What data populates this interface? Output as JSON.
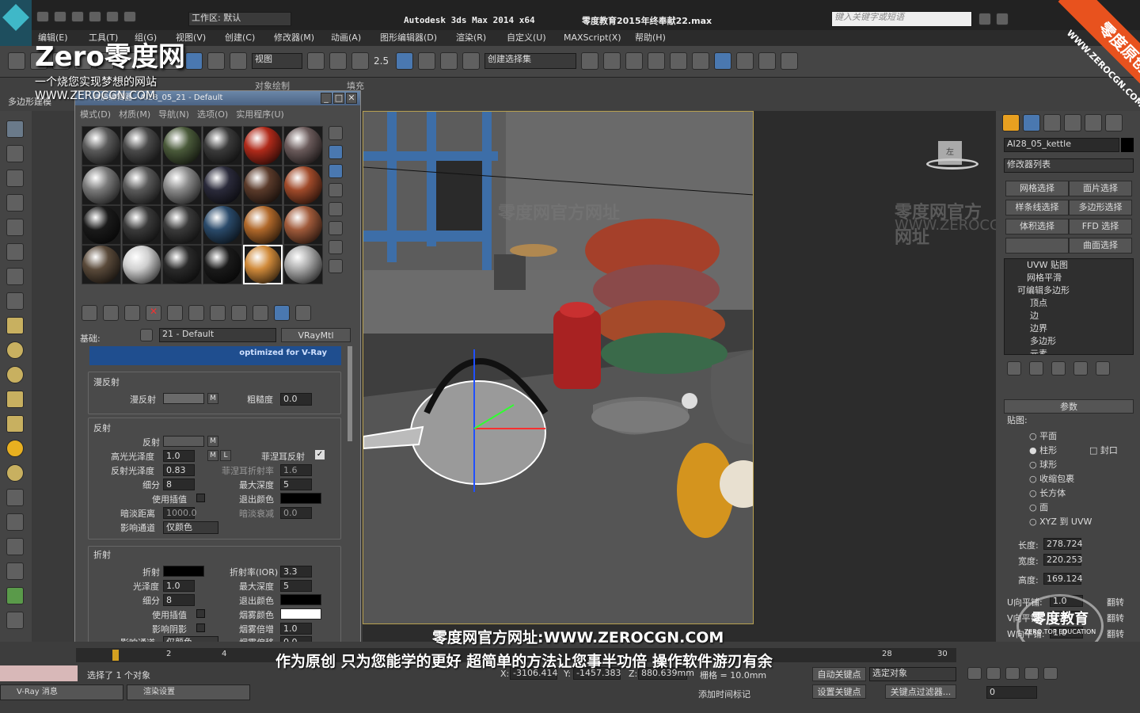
{
  "titlebar": {
    "title": "Autodesk 3ds Max  2014 x64",
    "file": "零度教育2015年终奉献22.max",
    "workspace": "工作区: 默认",
    "search_placeholder": "键入关键字或短语"
  },
  "menu": [
    "编辑(E)",
    "工具(T)",
    "组(G)",
    "视图(V)",
    "创建(C)",
    "修改器(M)",
    "动画(A)",
    "图形编辑器(D)",
    "渲染(R)",
    "自定义(U)",
    "MAXScript(X)",
    "帮助(H)"
  ],
  "toolbar": {
    "view_label": "视图",
    "selset_label": "创建选择集",
    "snap_label": "2.5"
  },
  "ribbon": {
    "tab_poly": "多边形建模",
    "tab_freeform": "对象绘制",
    "tab_fill": "填充"
  },
  "watermark": {
    "logo": "Zero零度网",
    "slogan": "一个烧您实现梦想的网站",
    "url": "WWW.ZEROCGN.COM",
    "site": "零度网官方网址",
    "corner": "零度原创",
    "corner_url": "WWW.ZEROCGN.COM",
    "edu": "零度教育",
    "edu_sub": "ZERO TOP EDUCATION"
  },
  "material_editor": {
    "title": "材质编辑器 - AI28_05_21 - Default",
    "menu": [
      "模式(D)",
      "材质(M)",
      "导航(N)",
      "选项(O)",
      "实用程序(U)"
    ],
    "basic_label": "基础:",
    "mat_name": "21 - Default",
    "mat_type": "VRayMtl",
    "banner": "optimized for V-Ray",
    "diffuse_group": "漫反射",
    "diffuse": "漫反射",
    "roughness": "粗糙度",
    "roughness_val": "0.0",
    "m": "M",
    "l": "L",
    "reflect_group": "反射",
    "reflect": "反射",
    "hilight_gloss": "高光光泽度",
    "hilight_val": "1.0",
    "fresnel": "菲涅耳反射",
    "refl_gloss": "反射光泽度",
    "refl_gloss_val": "0.83",
    "fresnel_ior": "菲涅耳折射率",
    "fresnel_ior_val": "1.6",
    "subdivs": "细分",
    "subdivs_val": "8",
    "max_depth": "最大深度",
    "max_depth_val": "5",
    "use_interp": "使用插值",
    "exit_color": "退出颜色",
    "dim_dist": "暗淡距离",
    "dim_dist_val": "1000.0",
    "dim_falloff": "暗淡衰减",
    "dim_falloff_val": "0.0",
    "affect_ch": "影响通道",
    "affect_ch_val": "仅颜色",
    "refract_group": "折射",
    "refract": "折射",
    "ior": "折射率(IOR)",
    "ior_val": "3.3",
    "gloss": "光泽度",
    "gloss_val": "1.0",
    "max_depth2_val": "5",
    "subdivs2_val": "8",
    "fog_color": "烟雾颜色",
    "fog_mult": "烟雾倍增",
    "fog_mult_val": "1.0",
    "affect_shadow": "影响阴影",
    "fog_bias": "烟雾偏移",
    "fog_bias_val": "0.0",
    "affect_ch2": "影响通道",
    "affect_ch2_val": "仅颜色"
  },
  "right_panel": {
    "object_name": "AI28_05_kettle",
    "modifier_list": "修改器列表",
    "buttons": [
      "网格选择",
      "面片选择",
      "样条线选择",
      "多边形选择",
      "体积选择",
      "FFD 选择",
      "",
      "曲面选择"
    ],
    "stack": [
      "UVW 贴图",
      "网格平滑",
      "可编辑多边形",
      "顶点",
      "边",
      "边界",
      "多边形",
      "元素"
    ],
    "params": "参数",
    "mapping": "贴图:",
    "options": [
      "平面",
      "柱形",
      "球形",
      "收缩包裹",
      "长方体",
      "面",
      "XYZ 到 UVW"
    ],
    "cap": "封口",
    "length_label": "长度:",
    "length": "278.724",
    "width_label": "宽度:",
    "width": "220.253",
    "height_label": "高度:",
    "height": "169.124",
    "u_tile": "U向平铺:",
    "u_val": "1.0",
    "v_tile": "V向平铺:",
    "v_val": "1.0",
    "w_tile": "W向平铺:",
    "w_val": "1.0",
    "flip": "翻转"
  },
  "viewport": {
    "label": "[ + ]",
    "cube": "左"
  },
  "subtitles": {
    "line1": "零度网官方网址:WWW.ZEROCGN.COM",
    "line2": "作为原创 只为您能学的更好 超简单的方法让您事半功倍 操作软件游刃有余"
  },
  "status": {
    "selected": "选择了 1 个对象",
    "x_label": "X:",
    "x": "-3106.414",
    "y_label": "Y:",
    "y": "-1457.383",
    "z_label": "Z:",
    "z": "880.639mm",
    "grid": "栅格 = 10.0mm",
    "autokey": "自动关键点",
    "setkey": "设置关键点",
    "selobj": "选定对象",
    "keyfilter": "关键点过滤器...",
    "addtime": "添加时间标记",
    "frame": "0"
  },
  "taskbar": [
    {
      "label": "V-Ray 消息"
    },
    {
      "label": "渲染设置"
    }
  ],
  "timeline": {
    "ticks": [
      "0",
      "2",
      "4",
      "28",
      "30"
    ]
  },
  "colors": {
    "accent": "#b8a050",
    "selected": "#4a78b0",
    "bg": "#3a3a3a"
  }
}
